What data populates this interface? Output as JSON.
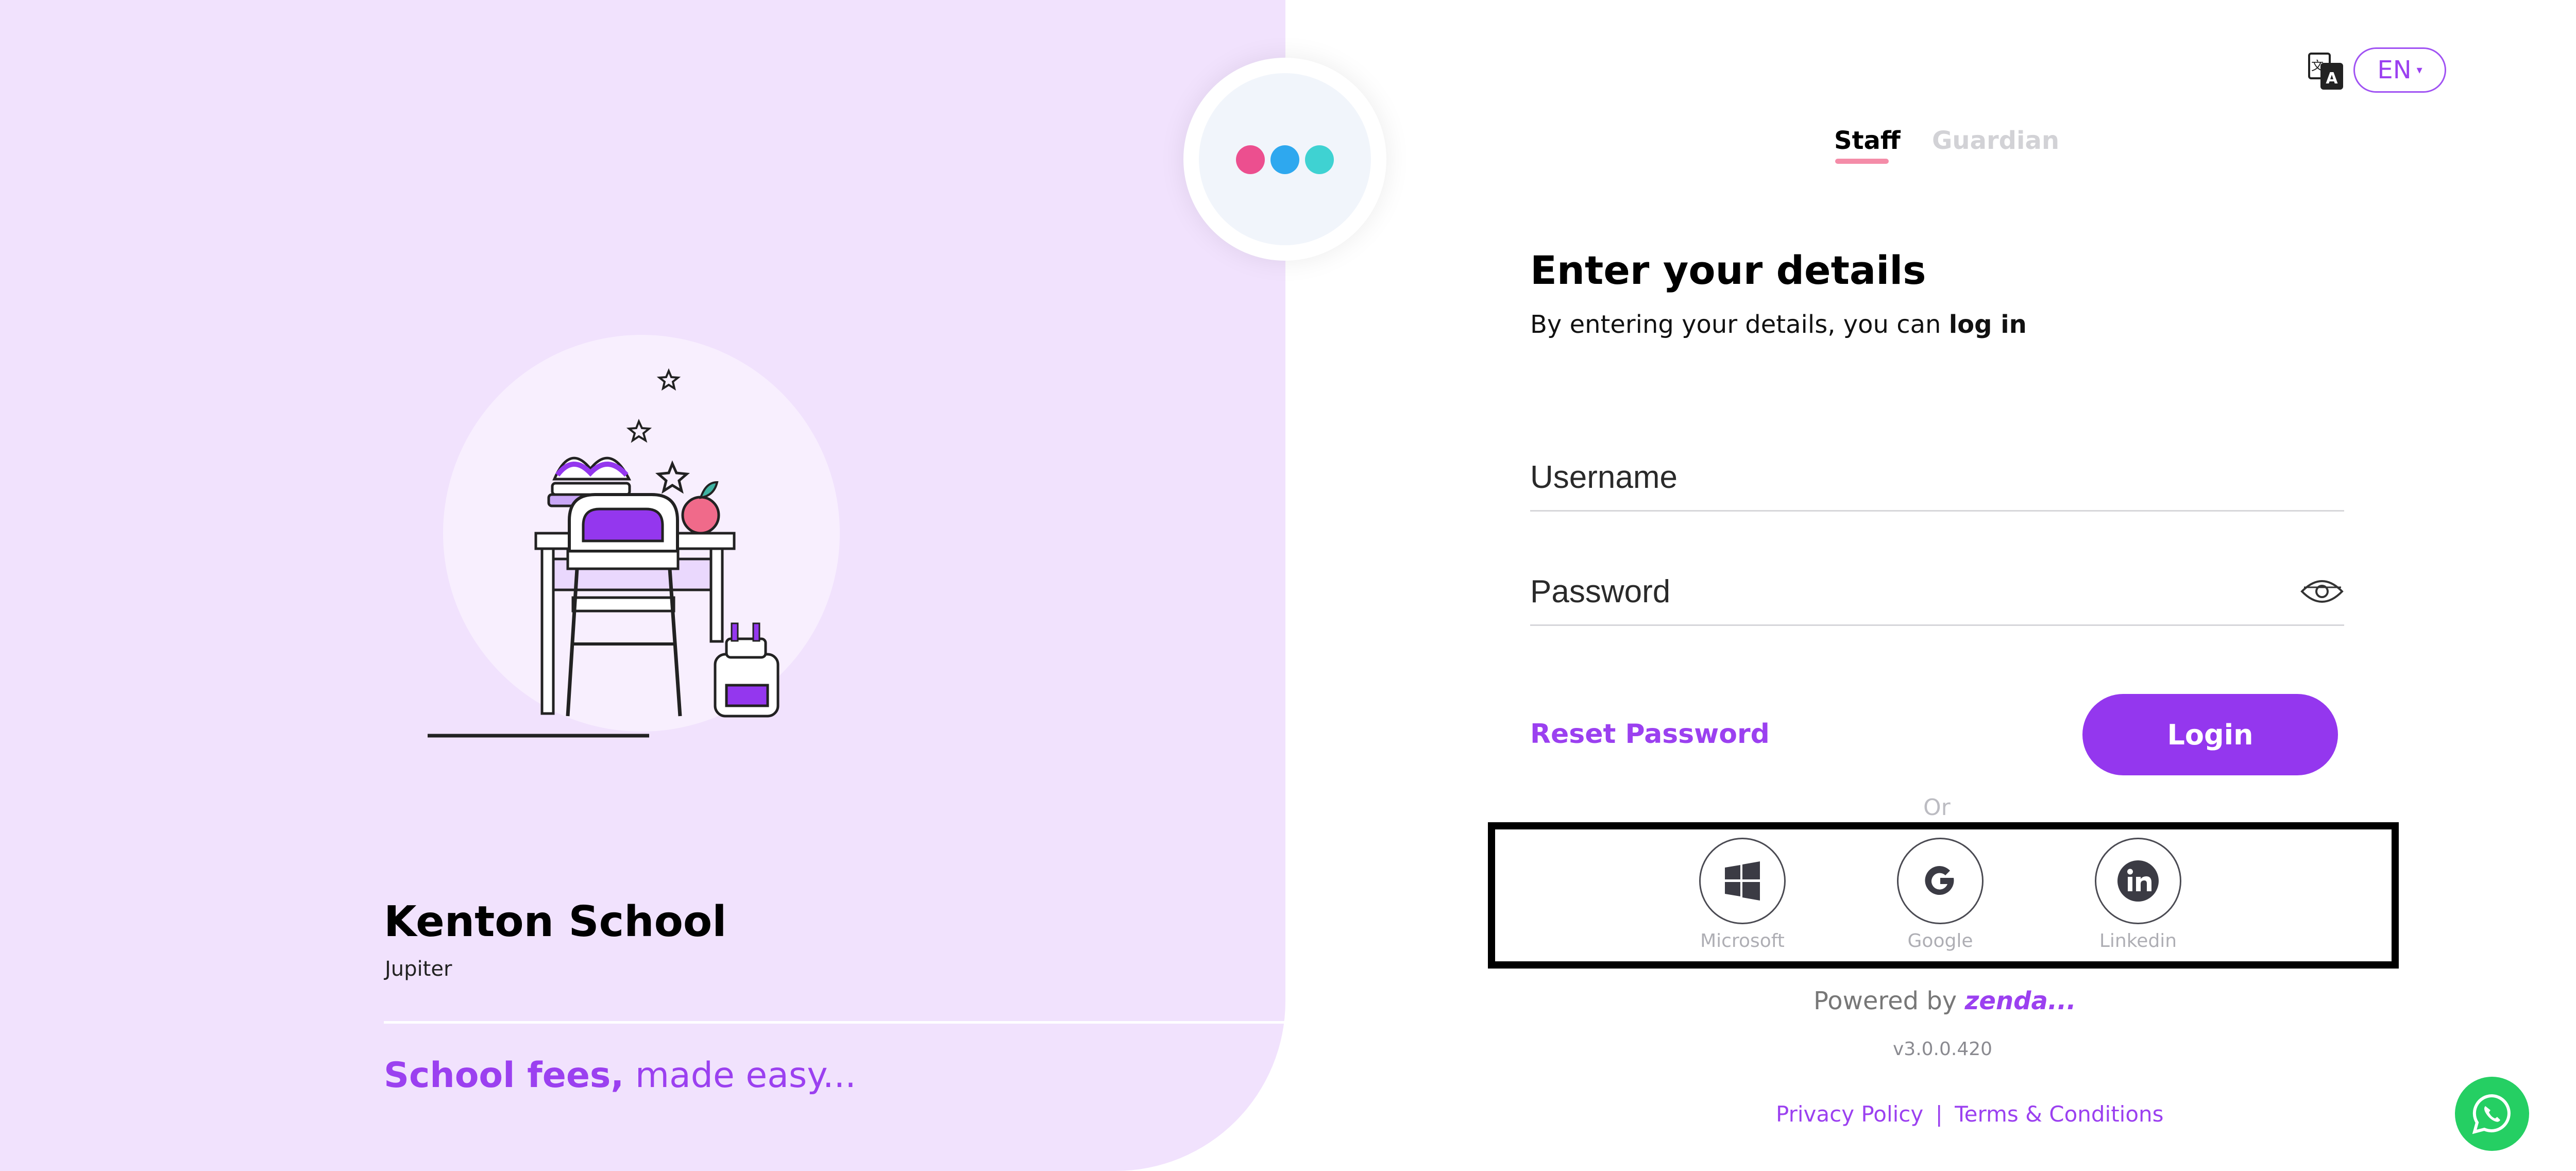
{
  "school": {
    "name": "Kenton School",
    "subtitle": "Jupiter"
  },
  "tagline": {
    "bold": "School fees,",
    "rest": "made easy..."
  },
  "language": {
    "icon": "translate-icon",
    "selected": "EN",
    "caret": "▾"
  },
  "tabs": [
    {
      "label": "Staff",
      "active": true
    },
    {
      "label": "Guardian",
      "active": false
    }
  ],
  "form": {
    "title": "Enter your details",
    "subtitle_prefix": "By entering your details, you can",
    "subtitle_bold": "log in",
    "username_placeholder": "Username",
    "password_placeholder": "Password",
    "reset_label": "Reset Password",
    "login_label": "Login",
    "or_label": "Or"
  },
  "social": [
    {
      "label": "Microsoft",
      "icon": "windows-icon"
    },
    {
      "label": "Google",
      "icon": "google-icon"
    },
    {
      "label": "Linkedin",
      "icon": "linkedin-icon"
    }
  ],
  "footer": {
    "powered_prefix": "Powered by",
    "powered_brand": "zenda...",
    "version": "v3.0.0.420",
    "privacy": "Privacy Policy",
    "separator": "|",
    "terms": "Terms & Conditions"
  },
  "colors": {
    "accent": "#9437ee",
    "left_bg": "#f1e2fd",
    "whatsapp": "#25cf63"
  }
}
